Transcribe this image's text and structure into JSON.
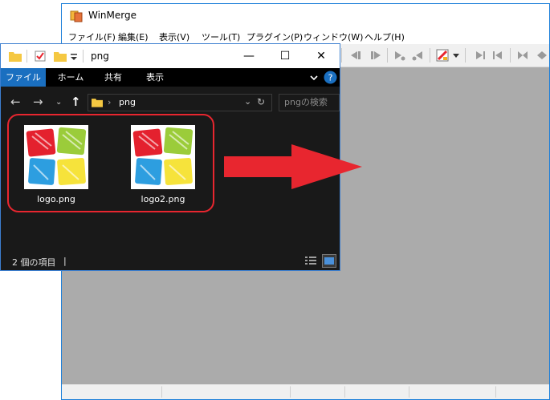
{
  "winmerge": {
    "title": "WinMerge",
    "menu": [
      "ファイル(F)",
      "編集(E)",
      "表示(V)",
      "ツール(T)",
      "プラグイン(P)",
      "ウィンドウ(W)",
      "ヘルプ(H)"
    ]
  },
  "explorer": {
    "title": "png",
    "ribbon_tabs": [
      "ファイル",
      "ホーム",
      "共有",
      "表示"
    ],
    "address_path": "png",
    "search_placeholder": "pngの検索",
    "files": [
      {
        "name": "logo.png"
      },
      {
        "name": "logo2.png"
      }
    ],
    "status_text": "2 個の項目",
    "status_cursor": "|"
  },
  "colors": {
    "accent": "#1a6fc0",
    "highlight_red": "#e8262f",
    "logo_red": "#e4212e",
    "logo_green": "#9bcc3a",
    "logo_blue": "#2d9ee0",
    "logo_yellow": "#f6e33b"
  }
}
